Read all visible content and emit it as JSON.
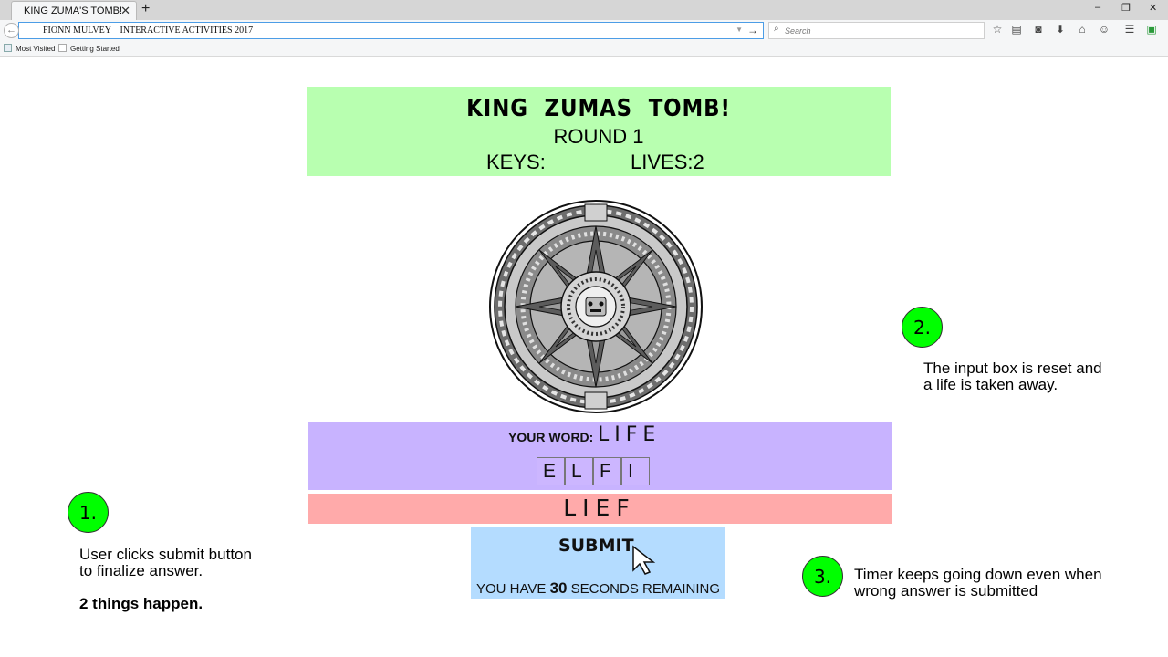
{
  "browser": {
    "tab_title": "KING ZUMA'S TOMB!",
    "tab_close": "✕",
    "new_tab": "+",
    "url": "FIONN MULVEY    INTERACTIVE ACTIVITIES 2017",
    "search_placeholder": "Search",
    "bookmarks": [
      "Most Visited",
      "Getting Started"
    ],
    "window_controls": [
      "–",
      "❐",
      "✕"
    ]
  },
  "game": {
    "title": "KING ZUMAS TOMB!",
    "round": "ROUND 1",
    "keys_label": "KEYS:",
    "lives_label": "LIVES:2",
    "word_label": "YOUR WORD:",
    "word_value": "LIFE",
    "tiles": [
      "E",
      "L",
      "F",
      "I"
    ],
    "answer": "LIEF",
    "submit_label": "SUBMIT",
    "timer_prefix": "YOU HAVE ",
    "timer_seconds": "30",
    "timer_suffix": " SECONDS REMAINING"
  },
  "annotations": {
    "step1_number": "1.",
    "step1_line1": "User clicks submit button",
    "step1_line2": "to finalize answer.",
    "step1_note": "2 things happen.",
    "step2_number": "2.",
    "step2_line1": "The input box is reset and",
    "step2_line2": "a life is taken away.",
    "step3_number": "3.",
    "step3_line1": "Timer keeps going down even when",
    "step3_line2": "wrong answer is submitted"
  },
  "colors": {
    "header_bg": "#b8ffb0",
    "word_bg": "#c8b3ff",
    "answer_bg": "#ffaaaa",
    "submit_bg": "#b4dcff",
    "bubble": "#00ff00"
  },
  "icons": [
    "back-icon",
    "forward-icon",
    "go-arrow-icon",
    "search-icon",
    "star-icon",
    "reader-icon",
    "pocket-icon",
    "download-icon",
    "home-icon",
    "chat-icon",
    "menu-icon",
    "extension-icon",
    "medallion-image",
    "mouse-cursor-icon"
  ]
}
